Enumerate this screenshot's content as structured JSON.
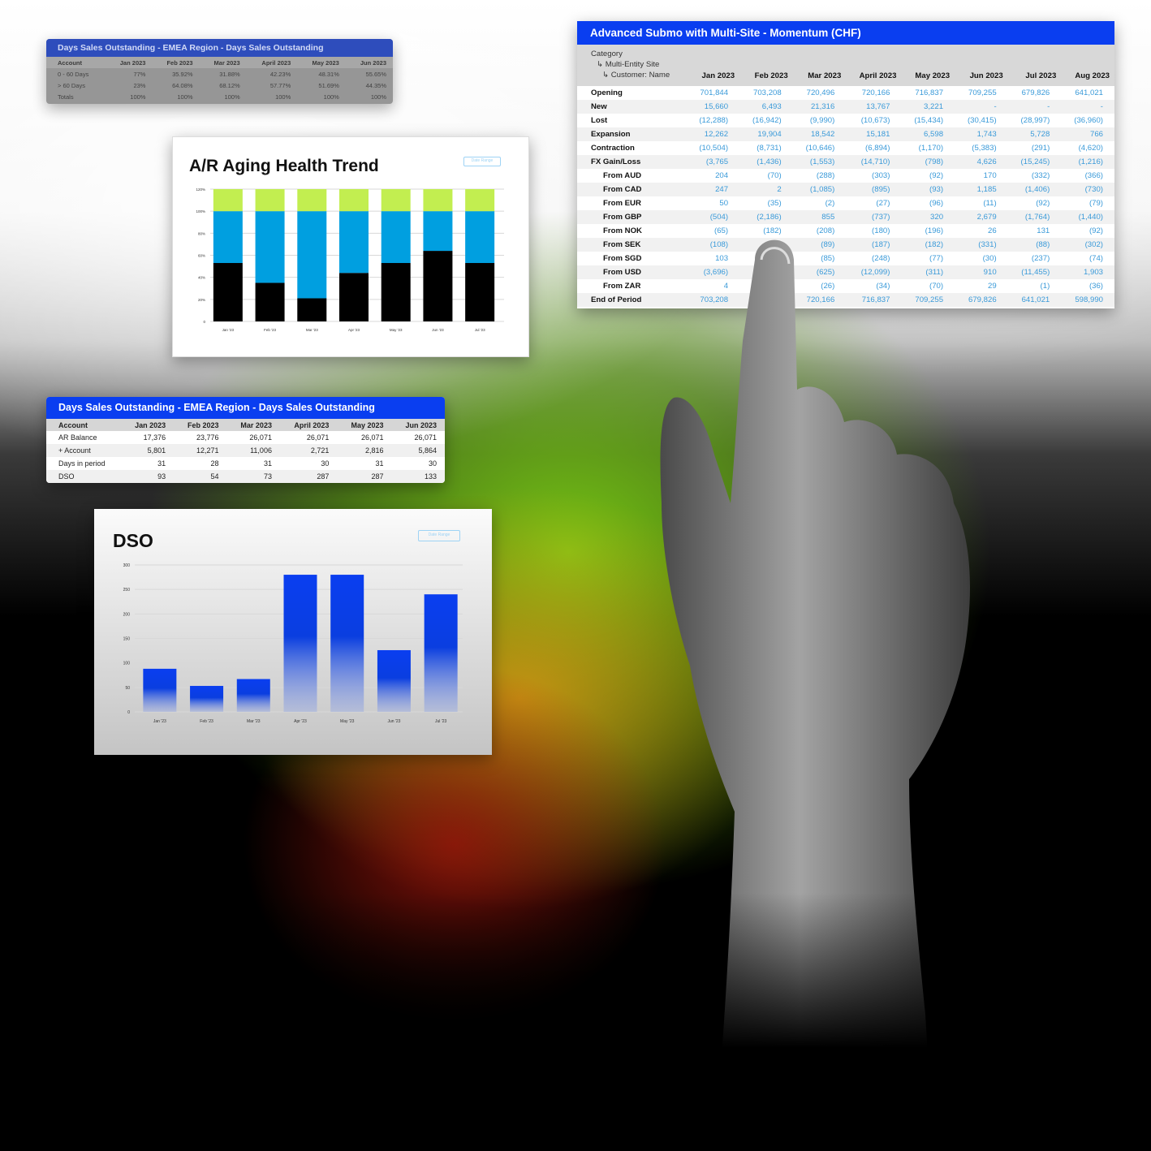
{
  "colors": {
    "brand_blue": "#0a3ef0",
    "value_blue": "#3a9ad9",
    "lime": "#c2ee50",
    "cyan": "#009fe0",
    "black": "#000000"
  },
  "dso_pct_table": {
    "title": "Days Sales Outstanding - EMEA Region - Days Sales Outstanding",
    "columns": [
      "Account",
      "Jan 2023",
      "Feb 2023",
      "Mar 2023",
      "April 2023",
      "May 2023",
      "Jun 2023"
    ],
    "rows": [
      [
        "0 - 60 Days",
        "77%",
        "35.92%",
        "31.88%",
        "42.23%",
        "48.31%",
        "55.65%"
      ],
      [
        "> 60 Days",
        "23%",
        "64.08%",
        "68.12%",
        "57.77%",
        "51.69%",
        "44.35%"
      ],
      [
        "Totals",
        "100%",
        "100%",
        "100%",
        "100%",
        "100%",
        "100%"
      ]
    ]
  },
  "dso_table": {
    "title": "Days Sales Outstanding - EMEA Region - Days Sales Outstanding",
    "columns": [
      "Account",
      "Jan 2023",
      "Feb 2023",
      "Mar 2023",
      "April 2023",
      "May 2023",
      "Jun 2023"
    ],
    "rows": [
      [
        "AR Balance",
        "17,376",
        "23,776",
        "26,071",
        "26,071",
        "26,071",
        "26,071"
      ],
      [
        "+ Account",
        "5,801",
        "12,271",
        "11,006",
        "2,721",
        "2,816",
        "5,864"
      ],
      [
        "Days in period",
        "31",
        "28",
        "31",
        "30",
        "31",
        "30"
      ],
      [
        "DSO",
        "93",
        "54",
        "73",
        "287",
        "287",
        "133"
      ]
    ]
  },
  "momentum_table": {
    "title": "Advanced Submo with Multi-Site - Momentum (CHF)",
    "category_lines": [
      "Category",
      "↳ Multi-Entity Site",
      "↳ Customer: Name"
    ],
    "columns": [
      "Jan 2023",
      "Feb 2023",
      "Mar 2023",
      "April 2023",
      "May 2023",
      "Jun 2023",
      "Jul 2023",
      "Aug 2023"
    ],
    "rows": [
      {
        "label": "Opening",
        "sub": false,
        "values": [
          "701,844",
          "703,208",
          "720,496",
          "720,166",
          "716,837",
          "709,255",
          "679,826",
          "641,021"
        ]
      },
      {
        "label": "New",
        "sub": false,
        "values": [
          "15,660",
          "6,493",
          "21,316",
          "13,767",
          "3,221",
          "-",
          "-",
          "-"
        ]
      },
      {
        "label": "Lost",
        "sub": false,
        "values": [
          "(12,288)",
          "(16,942)",
          "(9,990)",
          "(10,673)",
          "(15,434)",
          "(30,415)",
          "(28,997)",
          "(36,960)"
        ]
      },
      {
        "label": "Expansion",
        "sub": false,
        "values": [
          "12,262",
          "19,904",
          "18,542",
          "15,181",
          "6,598",
          "1,743",
          "5,728",
          "766"
        ]
      },
      {
        "label": "Contraction",
        "sub": false,
        "values": [
          "(10,504)",
          "(8,731)",
          "(10,646)",
          "(6,894)",
          "(1,170)",
          "(5,383)",
          "(291)",
          "(4,620)"
        ]
      },
      {
        "label": "FX Gain/Loss",
        "sub": false,
        "values": [
          "(3,765",
          "(1,436)",
          "(1,553)",
          "(14,710)",
          "(798)",
          "4,626",
          "(15,245)",
          "(1,216)"
        ]
      },
      {
        "label": "From AUD",
        "sub": true,
        "values": [
          "204",
          "(70)",
          "(288)",
          "(303)",
          "(92)",
          "170",
          "(332)",
          "(366)"
        ]
      },
      {
        "label": "From CAD",
        "sub": true,
        "values": [
          "247",
          "2",
          "(1,085)",
          "(895)",
          "(93)",
          "1,185",
          "(1,406)",
          "(730)"
        ]
      },
      {
        "label": "From EUR",
        "sub": true,
        "values": [
          "50",
          "(35)",
          "(2)",
          "(27)",
          "(96)",
          "(11)",
          "(92)",
          "(79)"
        ]
      },
      {
        "label": "From GBP",
        "sub": true,
        "values": [
          "(504)",
          "(2,186)",
          "855",
          "(737)",
          "320",
          "2,679",
          "(1,764)",
          "(1,440)"
        ]
      },
      {
        "label": "From NOK",
        "sub": true,
        "values": [
          "(65)",
          "(182)",
          "(208)",
          "(180)",
          "(196)",
          "26",
          "131",
          "(92)"
        ]
      },
      {
        "label": "From SEK",
        "sub": true,
        "values": [
          "(108)",
          "",
          "(89)",
          "(187)",
          "(182)",
          "(331)",
          "(88)",
          "(302)"
        ]
      },
      {
        "label": "From SGD",
        "sub": true,
        "values": [
          "103",
          "",
          "(85)",
          "(248)",
          "(77)",
          "(30)",
          "(237)",
          "(74)"
        ]
      },
      {
        "label": "From USD",
        "sub": true,
        "values": [
          "(3,696)",
          "",
          "(625)",
          "(12,099)",
          "(311)",
          "910",
          "(11,455)",
          "1,903"
        ]
      },
      {
        "label": "From ZAR",
        "sub": true,
        "values": [
          "4",
          "",
          "(26)",
          "(34)",
          "(70)",
          "29",
          "(1)",
          "(36)"
        ]
      },
      {
        "label": "End of Period",
        "sub": false,
        "values": [
          "703,208",
          "",
          "720,166",
          "716,837",
          "709,255",
          "679,826",
          "641,021",
          "598,990"
        ]
      }
    ]
  },
  "chart_data": [
    {
      "type": "bar",
      "stacked": true,
      "title": "A/R Aging Health Trend",
      "button": "Date Range",
      "categories": [
        "Jan '23",
        "Feb '23",
        "Mar '23",
        "Apr '23",
        "May '23",
        "Jun '23",
        "Jul '23"
      ],
      "ylim": [
        0,
        120
      ],
      "yticks": [
        "0",
        "20%",
        "40%",
        "60%",
        "80%",
        "100%",
        "120%"
      ],
      "grid": true,
      "series": [
        {
          "color": "#000000",
          "values": [
            53,
            35,
            21,
            44,
            53,
            64,
            53
          ]
        },
        {
          "color": "#009fe0",
          "values": [
            47,
            65,
            79,
            56,
            47,
            36,
            47
          ]
        },
        {
          "color": "#c2ee50",
          "values": [
            20,
            20,
            20,
            20,
            20,
            20,
            20
          ]
        }
      ]
    },
    {
      "type": "bar",
      "title": "DSO",
      "button": "Date Range",
      "categories": [
        "Jan '23",
        "Feb '23",
        "Mar '23",
        "Apr '23",
        "May '23",
        "Jun '23",
        "Jul '23"
      ],
      "values": [
        88,
        53,
        67,
        280,
        280,
        126,
        240
      ],
      "ylim": [
        0,
        300
      ],
      "yticks": [
        "0",
        "50",
        "100",
        "150",
        "200",
        "250",
        "300"
      ],
      "grid": true,
      "color": "#0a3ef0"
    }
  ]
}
